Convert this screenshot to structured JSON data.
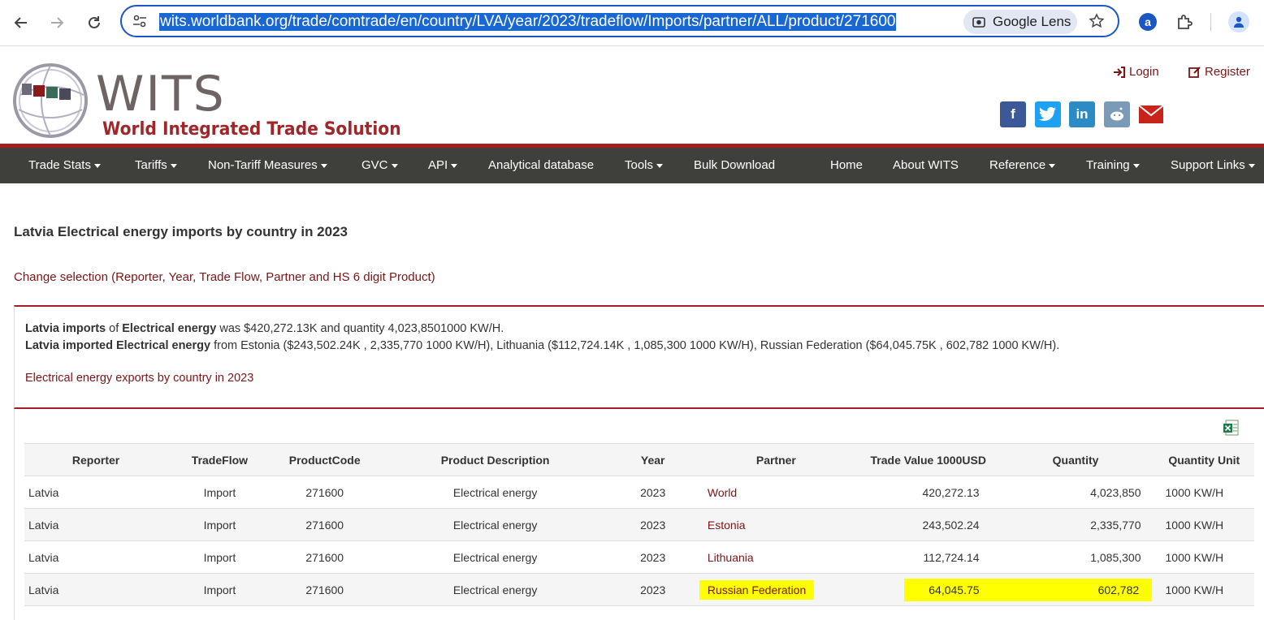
{
  "browser": {
    "url": "wits.worldbank.org/trade/comtrade/en/country/LVA/year/2023/tradeflow/Imports/partner/ALL/product/271600",
    "lens_label": "Google Lens"
  },
  "header": {
    "logo_main": "WITS",
    "logo_sub": "World Integrated Trade Solution",
    "login": "Login",
    "register": "Register"
  },
  "nav": {
    "items": [
      {
        "label": "Trade Stats",
        "dropdown": true
      },
      {
        "label": "Tariffs",
        "dropdown": true
      },
      {
        "label": "Non-Tariff Measures",
        "dropdown": true
      },
      {
        "label": "GVC",
        "dropdown": true
      },
      {
        "label": "API",
        "dropdown": true
      },
      {
        "label": "Analytical database",
        "dropdown": false
      },
      {
        "label": "Tools",
        "dropdown": true
      },
      {
        "label": "Bulk Download",
        "dropdown": false
      },
      {
        "label": "Home",
        "dropdown": false
      },
      {
        "label": "About WITS",
        "dropdown": false
      },
      {
        "label": "Reference",
        "dropdown": true
      },
      {
        "label": "Training",
        "dropdown": true
      },
      {
        "label": "Support Links",
        "dropdown": true
      }
    ]
  },
  "page": {
    "title": "Latvia Electrical energy imports by country in 2023",
    "change_selection": "Change selection (Reporter, Year, Trade Flow, Partner and HS 6 digit Product)",
    "summary1": {
      "b1": "Latvia imports",
      "t1": " of ",
      "b2": "Electrical energy",
      "t2": " was $420,272.13K and quantity 4,023,8501000 KW/H."
    },
    "summary2": {
      "b1": "Latvia imported Electrical energy",
      "t1": " from Estonia ($243,502.24K , 2,335,770 1000 KW/H), Lithuania ($112,724.14K , 1,085,300 1000 KW/H), Russian Federation ($64,045.75K , 602,782 1000 KW/H)."
    },
    "export_link": "Electrical energy exports by country in 2023"
  },
  "table": {
    "headers": [
      "Reporter",
      "TradeFlow",
      "ProductCode",
      "Product Description",
      "Year",
      "Partner",
      "Trade Value 1000USD",
      "Quantity",
      "Quantity Unit"
    ],
    "rows": [
      [
        "Latvia",
        "Import",
        "271600",
        "Electrical energy",
        "2023",
        "World",
        "420,272.13",
        "4,023,850",
        "1000 KW/H"
      ],
      [
        "Latvia",
        "Import",
        "271600",
        "Electrical energy",
        "2023",
        "Estonia",
        "243,502.24",
        "2,335,770",
        "1000 KW/H"
      ],
      [
        "Latvia",
        "Import",
        "271600",
        "Electrical energy",
        "2023",
        "Lithuania",
        "112,724.14",
        "1,085,300",
        "1000 KW/H"
      ],
      [
        "Latvia",
        "Import",
        "271600",
        "Electrical energy",
        "2023",
        "Russian Federation",
        "64,045.75",
        "602,782",
        "1000 KW/H"
      ]
    ],
    "highlighted_row": 3
  },
  "colors": {
    "brand_red": "#a71e22",
    "link_maroon": "#7b1516",
    "nav_bg": "#3f3f3c",
    "highlight": "#ffff00"
  }
}
